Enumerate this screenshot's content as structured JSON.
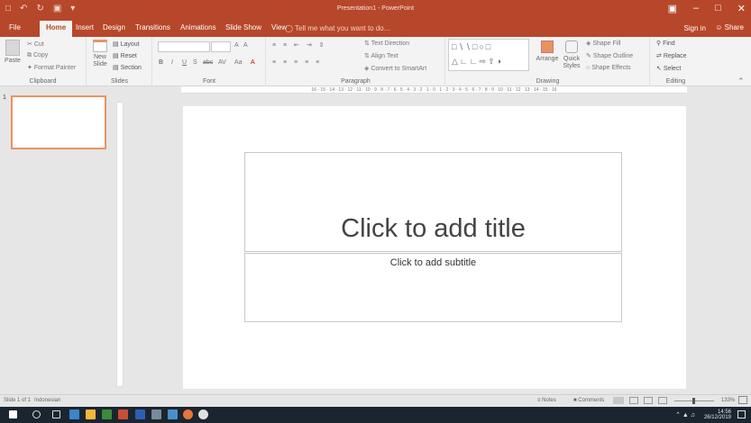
{
  "app": {
    "doc_title": "Presentation1 - PowerPoint",
    "sign_in": "Sign in",
    "share": "Share"
  },
  "tabs": [
    "File",
    "Home",
    "Insert",
    "Design",
    "Transitions",
    "Animations",
    "Slide Show",
    "View"
  ],
  "tell_me": "Tell me what you want to do...",
  "ribbon": {
    "clipboard": {
      "paste": "Paste",
      "cut": "Cut",
      "copy": "Copy",
      "format_painter": "Format Painter",
      "label": "Clipboard"
    },
    "slides": {
      "new_slide": "New Slide",
      "layout": "Layout",
      "reset": "Reset",
      "section": "Section",
      "label": "Slides"
    },
    "font": {
      "label": "Font",
      "bold": "B",
      "italic": "I",
      "underline": "U",
      "shadow": "S",
      "strike": "abc",
      "spacing": "AV",
      "case": "Aa",
      "grow": "A",
      "shrink": "A",
      "color": "A"
    },
    "paragraph": {
      "label": "Paragraph",
      "text_direction": "Text Direction",
      "align_text": "Align Text",
      "convert_smartart": "Convert to SmartArt"
    },
    "drawing": {
      "label": "Drawing",
      "arrange": "Arrange",
      "quick_styles": "Quick Styles",
      "shape_fill": "Shape Fill",
      "shape_outline": "Shape Outline",
      "shape_effects": "Shape Effects"
    },
    "editing": {
      "label": "Editing",
      "find": "Find",
      "replace": "Replace",
      "select": "Select"
    }
  },
  "ruler_text": "16 · 15 · 14 · 13 · 12 · 11 · 10 · 9 · 8 · 7 · 6 · 5 · 4 · 3 · 2 · 1 · 0 · 1 · 2 · 3 · 4 · 5 · 6 · 7 · 8 · 9 · 10 · 11 · 12 · 13 · 14 · 15 · 16",
  "thumbnails": [
    {
      "number": "1"
    }
  ],
  "slide": {
    "title_placeholder": "Click to add title",
    "subtitle_placeholder": "Click to add subtitle"
  },
  "status": {
    "slide_info": "Slide 1 of 1",
    "language": "Indonesian",
    "notes": "Notes",
    "comments": "Comments",
    "zoom": "133%"
  },
  "taskbar": {
    "time": "14:56",
    "date": "26/12/2019",
    "accents": [
      "#ffffff",
      "#3a86c8",
      "#f0b83c",
      "#3c8a3a",
      "#c94f34",
      "#2b5fb4",
      "#7a8a99",
      "#4a90c8",
      "#e8763a",
      "#e0e0e0"
    ]
  },
  "colors": {
    "brand": "#b7472a",
    "thumb_selected": "#e8935f"
  }
}
